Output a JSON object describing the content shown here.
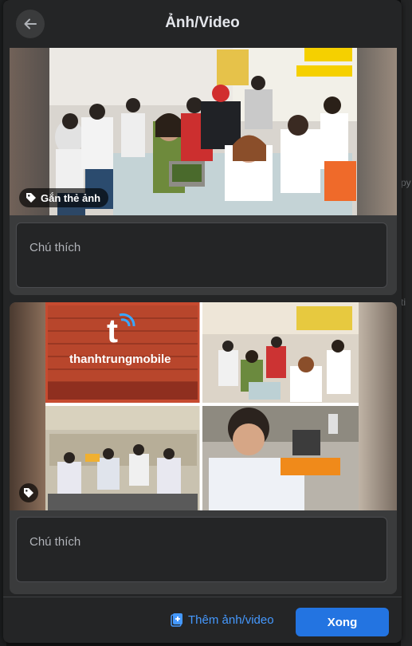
{
  "header": {
    "title": "Ảnh/Video"
  },
  "items": [
    {
      "caption_placeholder": "Chú thích",
      "tag_label": "Gắn thẻ ảnh"
    },
    {
      "caption_placeholder": "Chú thích",
      "sign_text": "thanhtrungmobile"
    }
  ],
  "footer": {
    "add_label": "Thêm ảnh/video",
    "done_label": "Xong"
  },
  "background_peek": [
    "py",
    "ti"
  ],
  "colors": {
    "dialog": "#242526",
    "card": "#3a3b3c",
    "accent": "#2374e1",
    "link": "#4599ff"
  }
}
